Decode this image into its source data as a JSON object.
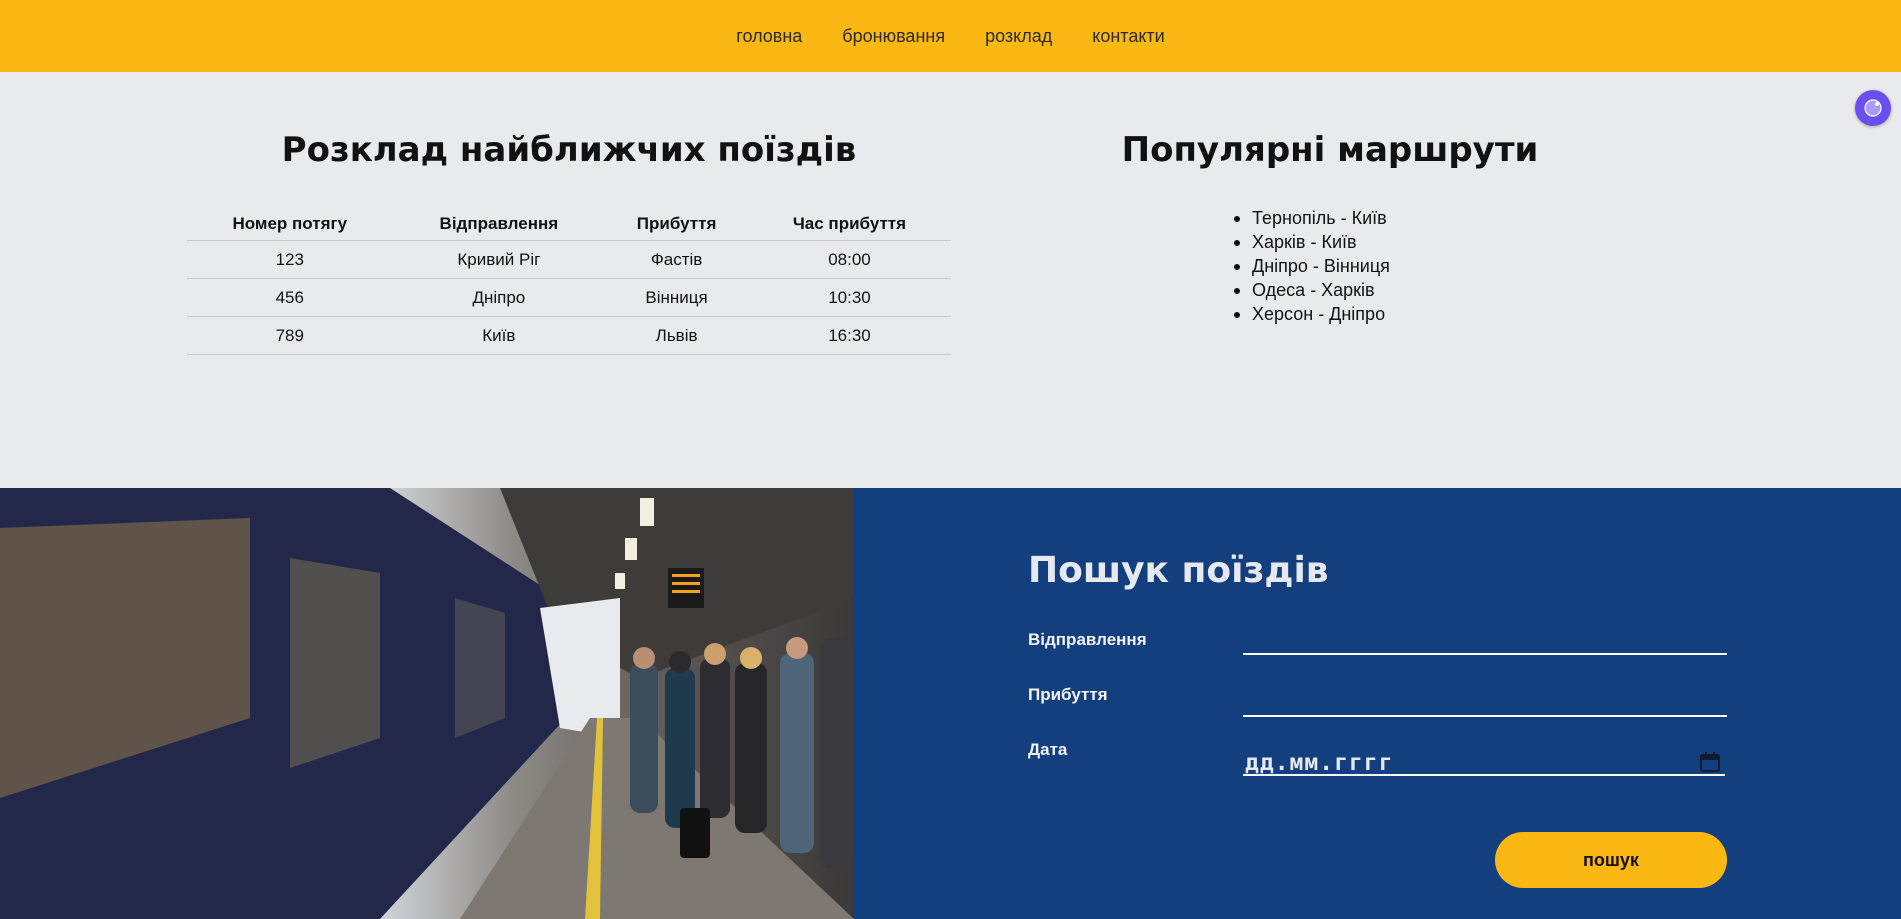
{
  "nav": {
    "items": [
      "головна",
      "бронювання",
      "розклад",
      "контакти"
    ]
  },
  "schedule": {
    "title": "Розклад найближчих поїздів",
    "headers": [
      "Номер потягу",
      "Відправлення",
      "Прибуття",
      "Час прибуття"
    ],
    "rows": [
      [
        "123",
        "Кривий Ріг",
        "Фастів",
        "08:00"
      ],
      [
        "456",
        "Дніпро",
        "Вінниця",
        "10:30"
      ],
      [
        "789",
        "Київ",
        "Львів",
        "16:30"
      ]
    ]
  },
  "routes": {
    "title": "Популярні маршрути",
    "items": [
      "Тернопіль - Київ",
      "Харків - Київ",
      "Дніпро - Вінниця",
      "Одеса - Харків",
      "Херсон - Дніпро"
    ]
  },
  "search": {
    "title": "Пошук поїздів",
    "departure_label": "Відправлення",
    "arrival_label": "Прибуття",
    "date_label": "Дата",
    "date_placeholder": "дд.мм.гггг",
    "button_label": "пошук"
  },
  "colors": {
    "nav_bg": "#fbb812",
    "page_bg": "#e9eaeb",
    "search_bg": "#143f7e",
    "button_bg": "#fbb812",
    "widget_bg": "#6b4ef0"
  },
  "icons": {
    "calendar": "calendar-icon",
    "widget": "assistant-widget-icon"
  }
}
